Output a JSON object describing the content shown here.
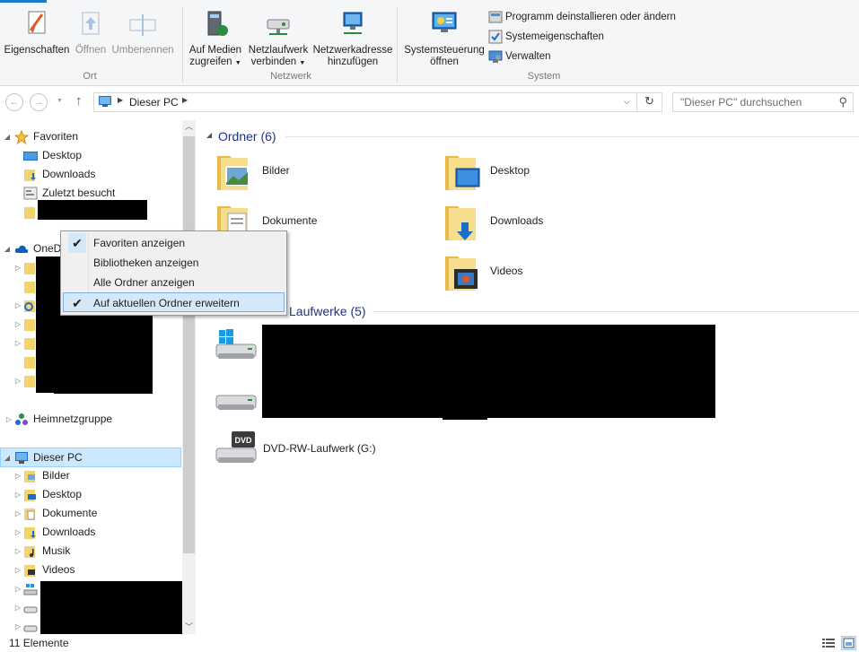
{
  "ribbon": {
    "accent": "#1979ca",
    "groups": {
      "ort": {
        "label": "Ort",
        "buttons": [
          {
            "label": "Eigenschaften",
            "icon": "properties-icon",
            "enabled": true
          },
          {
            "label": "Öffnen",
            "icon": "open-icon",
            "enabled": false
          },
          {
            "label": "Umbenennen",
            "icon": "rename-icon",
            "enabled": false
          }
        ]
      },
      "netzwerk": {
        "label": "Netzwerk",
        "buttons": [
          {
            "line1": "Auf Medien",
            "line2": "zugreifen",
            "icon": "media-icon"
          },
          {
            "line1": "Netzlaufwerk",
            "line2": "verbinden",
            "icon": "network-drive-icon"
          },
          {
            "line1": "Netzwerkadresse",
            "line2": "hinzufügen",
            "icon": "network-location-icon"
          }
        ]
      },
      "system": {
        "label": "System",
        "big": {
          "line1": "Systemsteuerung",
          "line2": "öffnen",
          "icon": "control-panel-icon"
        },
        "small": [
          {
            "label": "Programm deinstallieren oder ändern",
            "icon": "uninstall-icon"
          },
          {
            "label": "Systemeigenschaften",
            "icon": "system-properties-icon"
          },
          {
            "label": "Verwalten",
            "icon": "manage-icon"
          }
        ]
      }
    }
  },
  "address": {
    "location": "Dieser PC",
    "search_placeholder": "\"Dieser PC\" durchsuchen"
  },
  "navpane": {
    "favorites_label": "Favoriten",
    "favorites": [
      "Desktop",
      "Downloads",
      "Zuletzt besucht"
    ],
    "onedrive_label": "OneD",
    "onedrive_fragment": "k",
    "homegroup_label": "Heimnetzgruppe",
    "thispc_label": "Dieser PC",
    "thispc_children": [
      "Bilder",
      "Desktop",
      "Dokumente",
      "Downloads",
      "Musik",
      "Videos"
    ]
  },
  "content": {
    "folders_header": "Ordner (6)",
    "folders": [
      {
        "name": "Bilder",
        "icon": "pictures-folder-icon"
      },
      {
        "name": "Desktop",
        "icon": "desktop-folder-icon"
      },
      {
        "name": "Dokumente",
        "icon": "documents-folder-icon"
      },
      {
        "name": "Downloads",
        "icon": "downloads-folder-icon"
      },
      {
        "name": "k",
        "icon": "music-folder-icon"
      },
      {
        "name": "Videos",
        "icon": "videos-folder-icon"
      }
    ],
    "devices_header_visible": "Laufwerke (5)",
    "devices": [
      {
        "name": "DVD-RW-Laufwerk (G:)",
        "icon": "dvd-drive-icon"
      }
    ]
  },
  "context_menu": {
    "items": [
      {
        "label": "Favoriten anzeigen",
        "checked": true
      },
      {
        "label": "Bibliotheken anzeigen",
        "checked": false
      },
      {
        "label": "Alle Ordner anzeigen",
        "checked": false
      },
      {
        "label": "Auf aktuellen Ordner erweitern",
        "checked": true
      }
    ]
  },
  "status": {
    "item_count": "11 Elemente"
  },
  "colors": {
    "header_text": "#1e3287",
    "selection": "#cce8ff",
    "folder_yellow": "#f3d36b"
  }
}
